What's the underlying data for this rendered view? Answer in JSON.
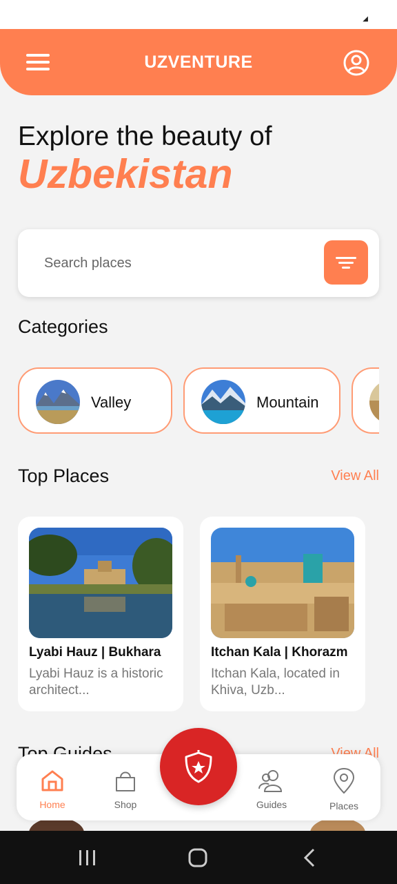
{
  "header": {
    "title": "UZVENTURE"
  },
  "hero": {
    "line1": "Explore the beauty of",
    "line2": "Uzbekistan"
  },
  "search": {
    "placeholder": "Search places"
  },
  "categories": {
    "title": "Categories",
    "items": [
      {
        "label": "Valley"
      },
      {
        "label": "Mountain"
      }
    ]
  },
  "top_places": {
    "title": "Top Places",
    "view_all": "View All",
    "items": [
      {
        "name": "Lyabi Hauz | Bukhara",
        "desc": "Lyabi Hauz is a historic architect..."
      },
      {
        "name": "Itchan Kala | Khorazm",
        "desc": "Itchan Kala, located in Khiva, Uzb..."
      }
    ]
  },
  "top_guides": {
    "title": "Top Guides",
    "view_all": "View All"
  },
  "nav": {
    "items": [
      {
        "label": "Home"
      },
      {
        "label": "Shop"
      },
      {
        "label": "Guides"
      },
      {
        "label": "Places"
      }
    ]
  },
  "colors": {
    "accent": "#ff7f50",
    "fab": "#d92525"
  }
}
